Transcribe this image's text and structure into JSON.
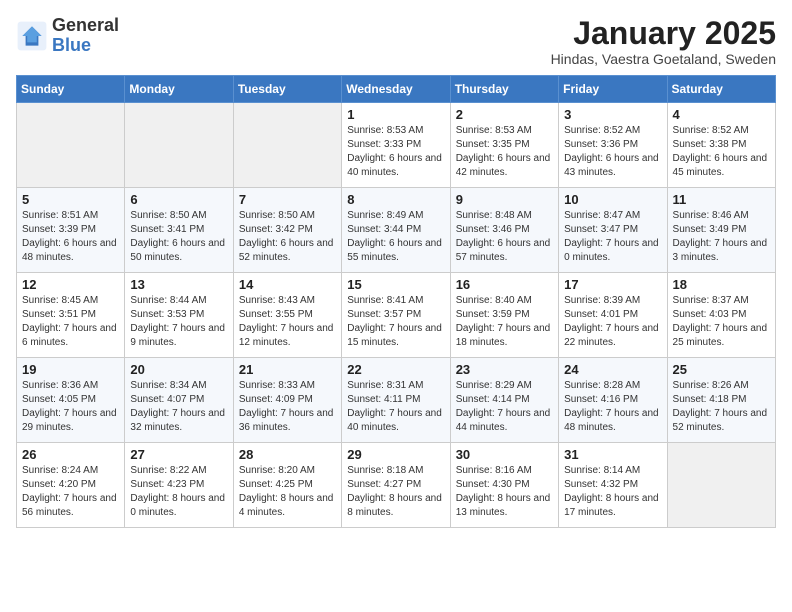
{
  "logo": {
    "line1": "General",
    "line2": "Blue"
  },
  "header": {
    "title": "January 2025",
    "subtitle": "Hindas, Vaestra Goetaland, Sweden"
  },
  "days_of_week": [
    "Sunday",
    "Monday",
    "Tuesday",
    "Wednesday",
    "Thursday",
    "Friday",
    "Saturday"
  ],
  "weeks": [
    [
      {
        "day": "",
        "sunrise": "",
        "sunset": "",
        "daylight": ""
      },
      {
        "day": "",
        "sunrise": "",
        "sunset": "",
        "daylight": ""
      },
      {
        "day": "",
        "sunrise": "",
        "sunset": "",
        "daylight": ""
      },
      {
        "day": "1",
        "sunrise": "Sunrise: 8:53 AM",
        "sunset": "Sunset: 3:33 PM",
        "daylight": "Daylight: 6 hours and 40 minutes."
      },
      {
        "day": "2",
        "sunrise": "Sunrise: 8:53 AM",
        "sunset": "Sunset: 3:35 PM",
        "daylight": "Daylight: 6 hours and 42 minutes."
      },
      {
        "day": "3",
        "sunrise": "Sunrise: 8:52 AM",
        "sunset": "Sunset: 3:36 PM",
        "daylight": "Daylight: 6 hours and 43 minutes."
      },
      {
        "day": "4",
        "sunrise": "Sunrise: 8:52 AM",
        "sunset": "Sunset: 3:38 PM",
        "daylight": "Daylight: 6 hours and 45 minutes."
      }
    ],
    [
      {
        "day": "5",
        "sunrise": "Sunrise: 8:51 AM",
        "sunset": "Sunset: 3:39 PM",
        "daylight": "Daylight: 6 hours and 48 minutes."
      },
      {
        "day": "6",
        "sunrise": "Sunrise: 8:50 AM",
        "sunset": "Sunset: 3:41 PM",
        "daylight": "Daylight: 6 hours and 50 minutes."
      },
      {
        "day": "7",
        "sunrise": "Sunrise: 8:50 AM",
        "sunset": "Sunset: 3:42 PM",
        "daylight": "Daylight: 6 hours and 52 minutes."
      },
      {
        "day": "8",
        "sunrise": "Sunrise: 8:49 AM",
        "sunset": "Sunset: 3:44 PM",
        "daylight": "Daylight: 6 hours and 55 minutes."
      },
      {
        "day": "9",
        "sunrise": "Sunrise: 8:48 AM",
        "sunset": "Sunset: 3:46 PM",
        "daylight": "Daylight: 6 hours and 57 minutes."
      },
      {
        "day": "10",
        "sunrise": "Sunrise: 8:47 AM",
        "sunset": "Sunset: 3:47 PM",
        "daylight": "Daylight: 7 hours and 0 minutes."
      },
      {
        "day": "11",
        "sunrise": "Sunrise: 8:46 AM",
        "sunset": "Sunset: 3:49 PM",
        "daylight": "Daylight: 7 hours and 3 minutes."
      }
    ],
    [
      {
        "day": "12",
        "sunrise": "Sunrise: 8:45 AM",
        "sunset": "Sunset: 3:51 PM",
        "daylight": "Daylight: 7 hours and 6 minutes."
      },
      {
        "day": "13",
        "sunrise": "Sunrise: 8:44 AM",
        "sunset": "Sunset: 3:53 PM",
        "daylight": "Daylight: 7 hours and 9 minutes."
      },
      {
        "day": "14",
        "sunrise": "Sunrise: 8:43 AM",
        "sunset": "Sunset: 3:55 PM",
        "daylight": "Daylight: 7 hours and 12 minutes."
      },
      {
        "day": "15",
        "sunrise": "Sunrise: 8:41 AM",
        "sunset": "Sunset: 3:57 PM",
        "daylight": "Daylight: 7 hours and 15 minutes."
      },
      {
        "day": "16",
        "sunrise": "Sunrise: 8:40 AM",
        "sunset": "Sunset: 3:59 PM",
        "daylight": "Daylight: 7 hours and 18 minutes."
      },
      {
        "day": "17",
        "sunrise": "Sunrise: 8:39 AM",
        "sunset": "Sunset: 4:01 PM",
        "daylight": "Daylight: 7 hours and 22 minutes."
      },
      {
        "day": "18",
        "sunrise": "Sunrise: 8:37 AM",
        "sunset": "Sunset: 4:03 PM",
        "daylight": "Daylight: 7 hours and 25 minutes."
      }
    ],
    [
      {
        "day": "19",
        "sunrise": "Sunrise: 8:36 AM",
        "sunset": "Sunset: 4:05 PM",
        "daylight": "Daylight: 7 hours and 29 minutes."
      },
      {
        "day": "20",
        "sunrise": "Sunrise: 8:34 AM",
        "sunset": "Sunset: 4:07 PM",
        "daylight": "Daylight: 7 hours and 32 minutes."
      },
      {
        "day": "21",
        "sunrise": "Sunrise: 8:33 AM",
        "sunset": "Sunset: 4:09 PM",
        "daylight": "Daylight: 7 hours and 36 minutes."
      },
      {
        "day": "22",
        "sunrise": "Sunrise: 8:31 AM",
        "sunset": "Sunset: 4:11 PM",
        "daylight": "Daylight: 7 hours and 40 minutes."
      },
      {
        "day": "23",
        "sunrise": "Sunrise: 8:29 AM",
        "sunset": "Sunset: 4:14 PM",
        "daylight": "Daylight: 7 hours and 44 minutes."
      },
      {
        "day": "24",
        "sunrise": "Sunrise: 8:28 AM",
        "sunset": "Sunset: 4:16 PM",
        "daylight": "Daylight: 7 hours and 48 minutes."
      },
      {
        "day": "25",
        "sunrise": "Sunrise: 8:26 AM",
        "sunset": "Sunset: 4:18 PM",
        "daylight": "Daylight: 7 hours and 52 minutes."
      }
    ],
    [
      {
        "day": "26",
        "sunrise": "Sunrise: 8:24 AM",
        "sunset": "Sunset: 4:20 PM",
        "daylight": "Daylight: 7 hours and 56 minutes."
      },
      {
        "day": "27",
        "sunrise": "Sunrise: 8:22 AM",
        "sunset": "Sunset: 4:23 PM",
        "daylight": "Daylight: 8 hours and 0 minutes."
      },
      {
        "day": "28",
        "sunrise": "Sunrise: 8:20 AM",
        "sunset": "Sunset: 4:25 PM",
        "daylight": "Daylight: 8 hours and 4 minutes."
      },
      {
        "day": "29",
        "sunrise": "Sunrise: 8:18 AM",
        "sunset": "Sunset: 4:27 PM",
        "daylight": "Daylight: 8 hours and 8 minutes."
      },
      {
        "day": "30",
        "sunrise": "Sunrise: 8:16 AM",
        "sunset": "Sunset: 4:30 PM",
        "daylight": "Daylight: 8 hours and 13 minutes."
      },
      {
        "day": "31",
        "sunrise": "Sunrise: 8:14 AM",
        "sunset": "Sunset: 4:32 PM",
        "daylight": "Daylight: 8 hours and 17 minutes."
      },
      {
        "day": "",
        "sunrise": "",
        "sunset": "",
        "daylight": ""
      }
    ]
  ]
}
